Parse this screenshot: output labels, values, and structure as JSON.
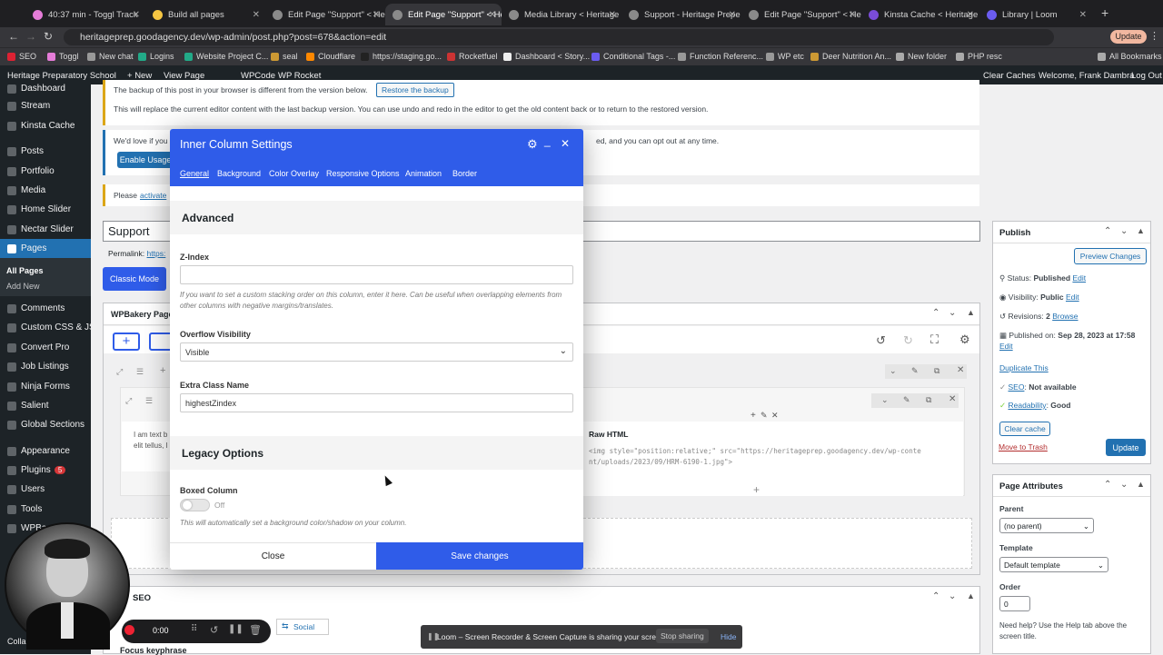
{
  "browser": {
    "tabs": [
      {
        "label": "40:37 min - Toggl Track",
        "color": "#e57cd8"
      },
      {
        "label": "Build all pages",
        "color": "#f5c542"
      },
      {
        "label": "Edit Page \"Support\" < He",
        "color": "#8a8a8a"
      },
      {
        "label": "Edit Page \"Support\" < He",
        "color": "#8a8a8a"
      },
      {
        "label": "Media Library < Heritage",
        "color": "#8a8a8a"
      },
      {
        "label": "Support - Heritage Prepe",
        "color": "#8a8a8a"
      },
      {
        "label": "Edit Page \"Support\" < He",
        "color": "#8a8a8a"
      },
      {
        "label": "Kinsta Cache < Heritage",
        "color": "#7a4cd8"
      },
      {
        "label": "Library | Loom",
        "color": "#6b5cf0"
      }
    ],
    "url": "heritageprep.goodagency.dev/wp-admin/post.php?post=678&action=edit",
    "update_label": "Update",
    "bookmarks": [
      "SEO",
      "Toggl",
      "New chat",
      "Logins",
      "Website Project C...",
      "seal",
      "Cloudflare",
      "https://staging.go...",
      "Rocketfuel",
      "Dashboard < Story...",
      "Conditional Tags -...",
      "Function Referenc...",
      "WP etc",
      "Deer Nutrition An...",
      "New folder",
      "PHP resc",
      "All Bookmarks"
    ]
  },
  "adminbar": {
    "site": "Heritage Preparatory School",
    "new": "New",
    "view_page": "View Page",
    "wpcode": "WPCode",
    "wprocket": "WP Rocket",
    "clear_caches": "Clear Caches",
    "welcome": "Welcome, Frank Dambra",
    "logout": "Log Out"
  },
  "sidebar": {
    "items": [
      "Dashboard",
      "Stream",
      "Kinsta Cache",
      "Posts",
      "Portfolio",
      "Media",
      "Home Slider",
      "Nectar Slider",
      "Pages"
    ],
    "sub": [
      "All Pages",
      "Add New"
    ],
    "items2": [
      "Comments",
      "Custom CSS & JS",
      "Convert Pro",
      "Job Listings",
      "Ninja Forms",
      "Salient",
      "Global Sections",
      "Appearance",
      "Plugins",
      "Users",
      "Tools",
      "WPBa"
    ],
    "plugins_badge": "5",
    "collapse": "Colla"
  },
  "notices": {
    "backup_text": "The backup of this post in your browser is different from the version below.",
    "restore_button": "Restore the backup",
    "backup_detail": "This will replace the current editor content with the last backup version. You can use undo and redo in the editor to get the old content back or to return to the restored version.",
    "usage_text": "We'd love if you",
    "usage_tail": "ed, and you can opt out at any time.",
    "usage_button": "Enable Usage T",
    "please": "Please",
    "activate": "activate"
  },
  "editor": {
    "title": "Support",
    "permalink": "Permalink:",
    "permalink_link": "https:",
    "classic_mode": "Classic Mode",
    "wpbakery": "WPBakery Page",
    "text_preview": "I am text b",
    "text_preview2": "elit tellus, l",
    "raw_html_label": "Raw HTML",
    "raw_html_code": "<img style=\"position:relative;\" src=\"https://heritageprep.goodagency.dev/wp-conte nt/uploads/2023/09/HRM-6190-1.jpg\">",
    "seo_label": "SEO",
    "social_label": "Social",
    "focus_keyphrase": "Focus keyphrase"
  },
  "publish": {
    "title": "Publish",
    "preview": "Preview Changes",
    "status": "Status: ",
    "status_val": "Published",
    "visibility": "Visibility: ",
    "visibility_val": "Public",
    "revisions": "Revisions: ",
    "revisions_val": "2",
    "browse": "Browse",
    "published_on": "Published on: ",
    "published_val": "Sep 28, 2023 at 17:58",
    "edit": "Edit",
    "duplicate": "Duplicate This",
    "seo": "SEO",
    "seo_val": "Not available",
    "readability": "Readability",
    "readability_val": "Good",
    "clear_cache": "Clear cache",
    "trash": "Move to Trash",
    "update": "Update"
  },
  "page_attributes": {
    "title": "Page Attributes",
    "parent_label": "Parent",
    "parent_val": "(no parent)",
    "template_label": "Template",
    "template_val": "Default template",
    "order_label": "Order",
    "order_val": "0",
    "help": "Need help? Use the Help tab above the screen title."
  },
  "modal": {
    "title": "Inner Column Settings",
    "tabs": [
      "General",
      "Background",
      "Color Overlay",
      "Responsive Options",
      "Animation",
      "Border"
    ],
    "section_advanced": "Advanced",
    "zindex_label": "Z-Index",
    "zindex_value": "",
    "zindex_help": "If you want to set a custom stacking order on this column, enter it here. Can be useful when overlapping elements from other columns with negative margins/translates.",
    "overflow_label": "Overflow Visibility",
    "overflow_value": "Visible",
    "extra_class_label": "Extra Class Name",
    "extra_class_value": "highestZindex",
    "section_legacy": "Legacy Options",
    "boxed_label": "Boxed Column",
    "boxed_state": "Off",
    "boxed_help": "This will automatically set a background color/shadow on your column.",
    "close": "Close",
    "save": "Save changes"
  },
  "loom": {
    "sharing": "Loom – Screen Recorder & Screen Capture is sharing your screen.",
    "stop": "Stop sharing",
    "hide": "Hide",
    "timer": "0:00"
  }
}
